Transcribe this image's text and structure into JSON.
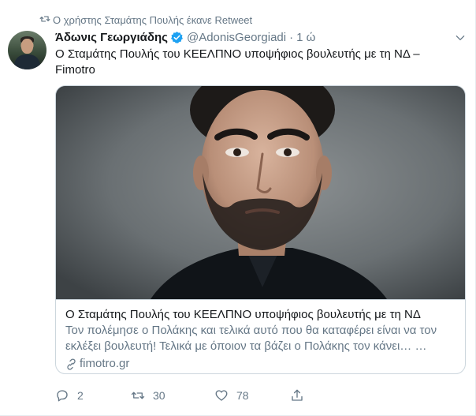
{
  "retweet_context": {
    "text": "Ο χρήστης Σταμάτης Πουλής έκανε Retweet",
    "icon": "retweet-icon"
  },
  "author": {
    "name": "Άδωνις Γεωργιάδης",
    "handle": "@AdonisGeorgiadi",
    "separator": "·",
    "time": "1 ώ",
    "verified": true,
    "verified_color": "#1da1f2"
  },
  "tweet": {
    "text": "Ο Σταμάτης Πουλής του ΚΕΕΛΠΝΟ υποψήφιος βουλευτής με τη ΝΔ – Fimotro"
  },
  "card": {
    "title": "Ο Σταμάτης Πουλής του ΚΕΕΛΠΝΟ υποψήφιος βουλευτής με τη ΝΔ",
    "description": "Τον πολέμησε ο Πολάκης και τελικά αυτό που θα καταφέρει είναι να τον εκλέξει βουλευτή! Τελικά με όποιον τα βάζει ο Πολάκης τον κάνει… …",
    "domain": "fimotro.gr"
  },
  "actions": {
    "reply_count": "2",
    "retweet_count": "30",
    "like_count": "78"
  },
  "colors": {
    "text_primary": "#14171a",
    "text_secondary": "#657786",
    "border": "#ccd6dd",
    "accent": "#1da1f2"
  }
}
